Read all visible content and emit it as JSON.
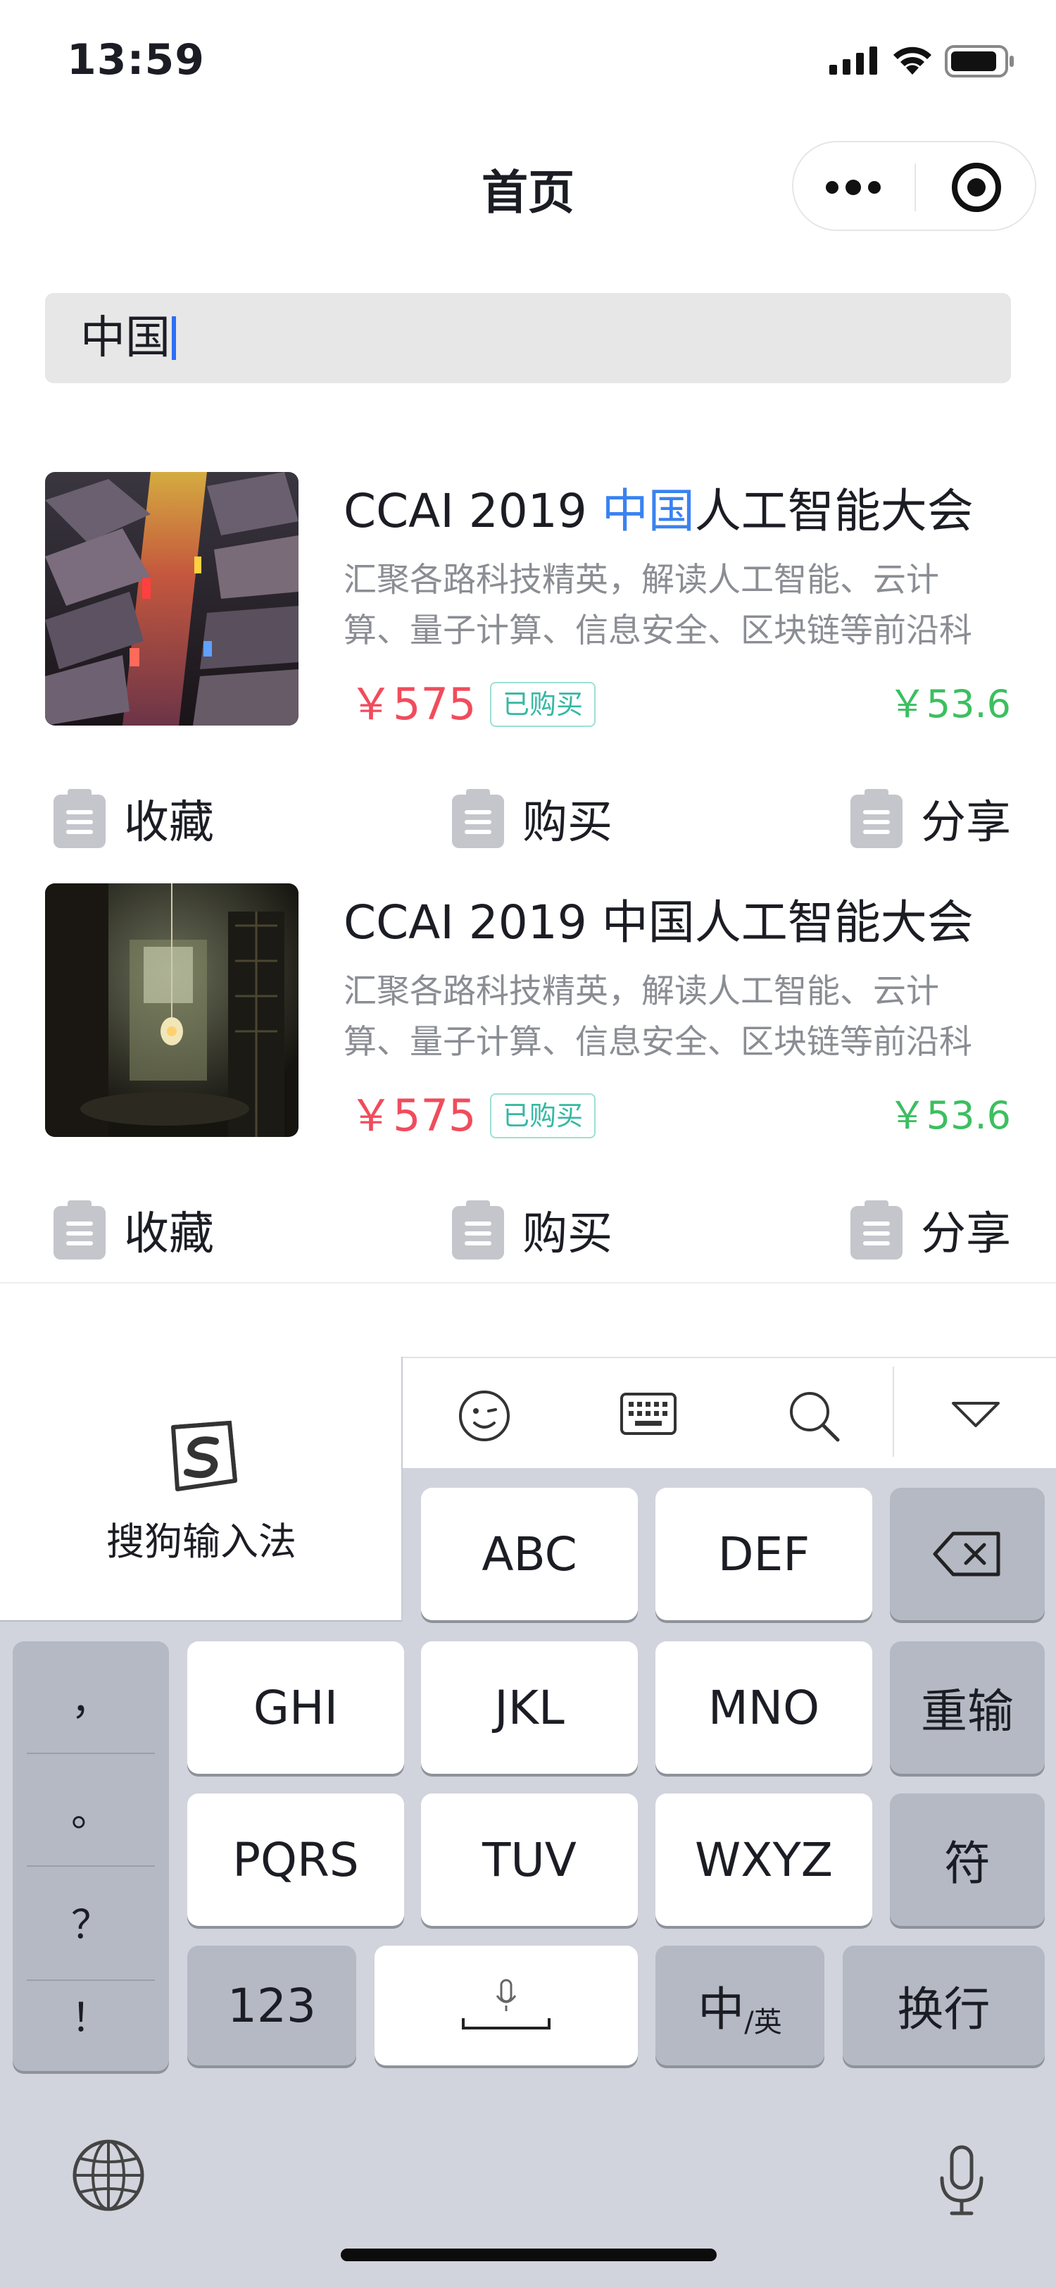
{
  "status_bar": {
    "time": "13:59"
  },
  "nav": {
    "title": "首页"
  },
  "search": {
    "value": "中国"
  },
  "products": [
    {
      "title_pre": "CCAI 2019 ",
      "title_hl": "中国",
      "title_post": "人工智能大会",
      "desc_line1": "汇聚各路科技精英，解读人工智能、云计",
      "desc_line2": "算、量子计算、信息安全、区块链等前沿科",
      "price": "￥575",
      "badge": "已购买",
      "price_right": "￥53.6",
      "actions": [
        "收藏",
        "购买",
        "分享"
      ]
    },
    {
      "title_pre": "CCAI 2019 中国人工智能大会",
      "title_hl": "",
      "title_post": "",
      "desc_line1": "汇聚各路科技精英，解读人工智能、云计",
      "desc_line2": "算、量子计算、信息安全、区块链等前沿科",
      "price": "￥575",
      "badge": "已购买",
      "price_right": "￥53.6",
      "actions": [
        "收藏",
        "购买",
        "分享"
      ]
    }
  ],
  "keyboard": {
    "ime_name": "搜狗输入法",
    "keys": {
      "abc": "ABC",
      "def": "DEF",
      "ghi": "GHI",
      "jkl": "JKL",
      "mno": "MNO",
      "pqrs": "PQRS",
      "tuv": "TUV",
      "wxyz": "WXYZ",
      "reenter": "重输",
      "symbols": "符",
      "numbers": "123",
      "lang_main": "中",
      "lang_sub": "/英",
      "newline": "换行"
    },
    "punctuation": [
      "，",
      "。",
      "？",
      "！"
    ]
  },
  "colors": {
    "highlight": "#3a82f0",
    "price": "#f04c5c",
    "price_right": "#3cbf60",
    "badge": "#35b8a3",
    "keyboard_bg": "#d1d4dc",
    "caret": "#2b6ef6"
  }
}
